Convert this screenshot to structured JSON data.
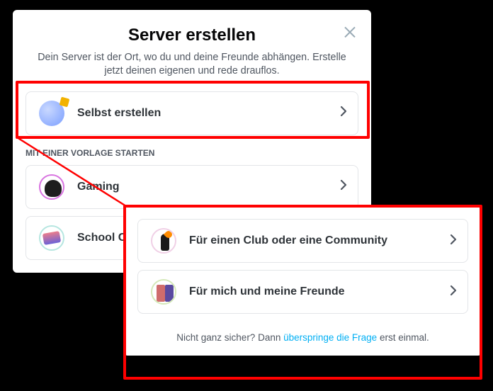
{
  "modal1": {
    "title": "Server erstellen",
    "subtitle": "Dein Server ist der Ort, wo du und deine Freunde abhängen. Erstelle jetzt deinen eigenen und rede drauflos.",
    "option_self": "Selbst erstellen",
    "template_header": "MIT EINER VORLAGE STARTEN",
    "option_gaming": "Gaming",
    "option_school": "School Cl"
  },
  "modal2": {
    "option_club": "Für einen Club oder eine Community",
    "option_friends": "Für mich und meine Freunde",
    "footer_prefix": "Nicht ganz sicher? Dann ",
    "footer_link": "überspringe die Frage",
    "footer_suffix": " erst einmal."
  }
}
